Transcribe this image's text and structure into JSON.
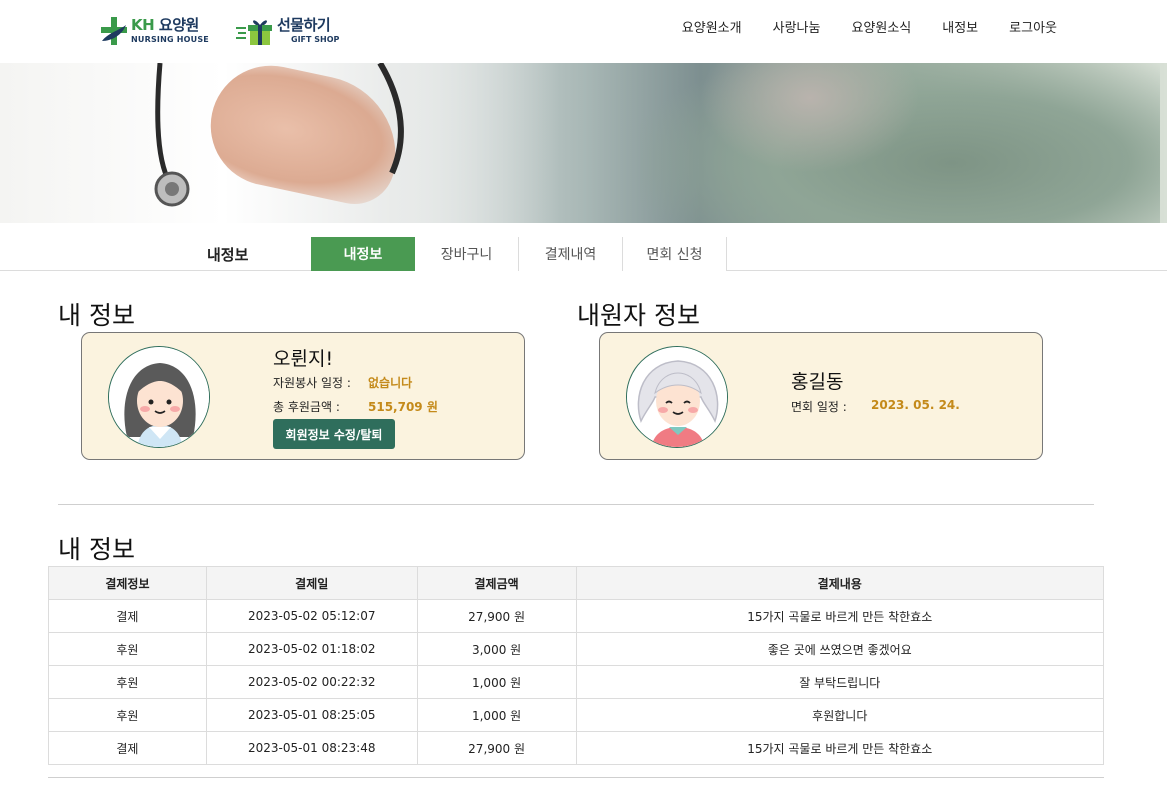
{
  "header": {
    "logo_kh": {
      "brand": "KH",
      "name": "요양원",
      "sub": "NURSING HOUSE"
    },
    "logo_gift": {
      "name": "선물하기",
      "sub": "GIFT SHOP"
    },
    "nav": [
      "요양원소개",
      "사랑나눔",
      "요양원소식",
      "내정보",
      "로그아웃"
    ]
  },
  "tabbar": {
    "heading": "내정보",
    "tabs": [
      "내정보",
      "장바구니",
      "결제내역",
      "면회 신청"
    ],
    "active": "내정보"
  },
  "my_info": {
    "title": "내 정보",
    "name": "오륀지!",
    "volunteer_label": "자원봉사 일정 :",
    "volunteer_value": "없습니다",
    "donation_label": "총 후원금액 :",
    "donation_value": "515,709 원",
    "edit_button": "회원정보 수정/탈퇴"
  },
  "resident_info": {
    "title": "내원자 정보",
    "name": "홍길동",
    "visit_label": "면회 일정 :",
    "visit_value": "2023. 05. 24."
  },
  "payments": {
    "title": "내 정보",
    "headers": [
      "결제정보",
      "결제일",
      "결제금액",
      "결제내용"
    ],
    "rows": [
      [
        "결제",
        "2023-05-02 05:12:07",
        "27,900 원",
        "15가지 곡물로 바르게 만든 착한효소"
      ],
      [
        "후원",
        "2023-05-02 01:18:02",
        "3,000 원",
        "좋은 곳에 쓰였으면 좋겠어요"
      ],
      [
        "후원",
        "2023-05-02 00:22:32",
        "1,000 원",
        "잘 부탁드립니다"
      ],
      [
        "후원",
        "2023-05-01 08:25:05",
        "1,000 원",
        "후원합니다"
      ],
      [
        "결제",
        "2023-05-01 08:23:48",
        "27,900 원",
        "15가지 곡물로 바르게 만든 착한효소"
      ]
    ]
  },
  "colors": {
    "accent_green": "#4a9a52",
    "dark_teal": "#2f6e5c",
    "card_bg": "#fbf3df",
    "value_gold": "#c48a1a"
  }
}
